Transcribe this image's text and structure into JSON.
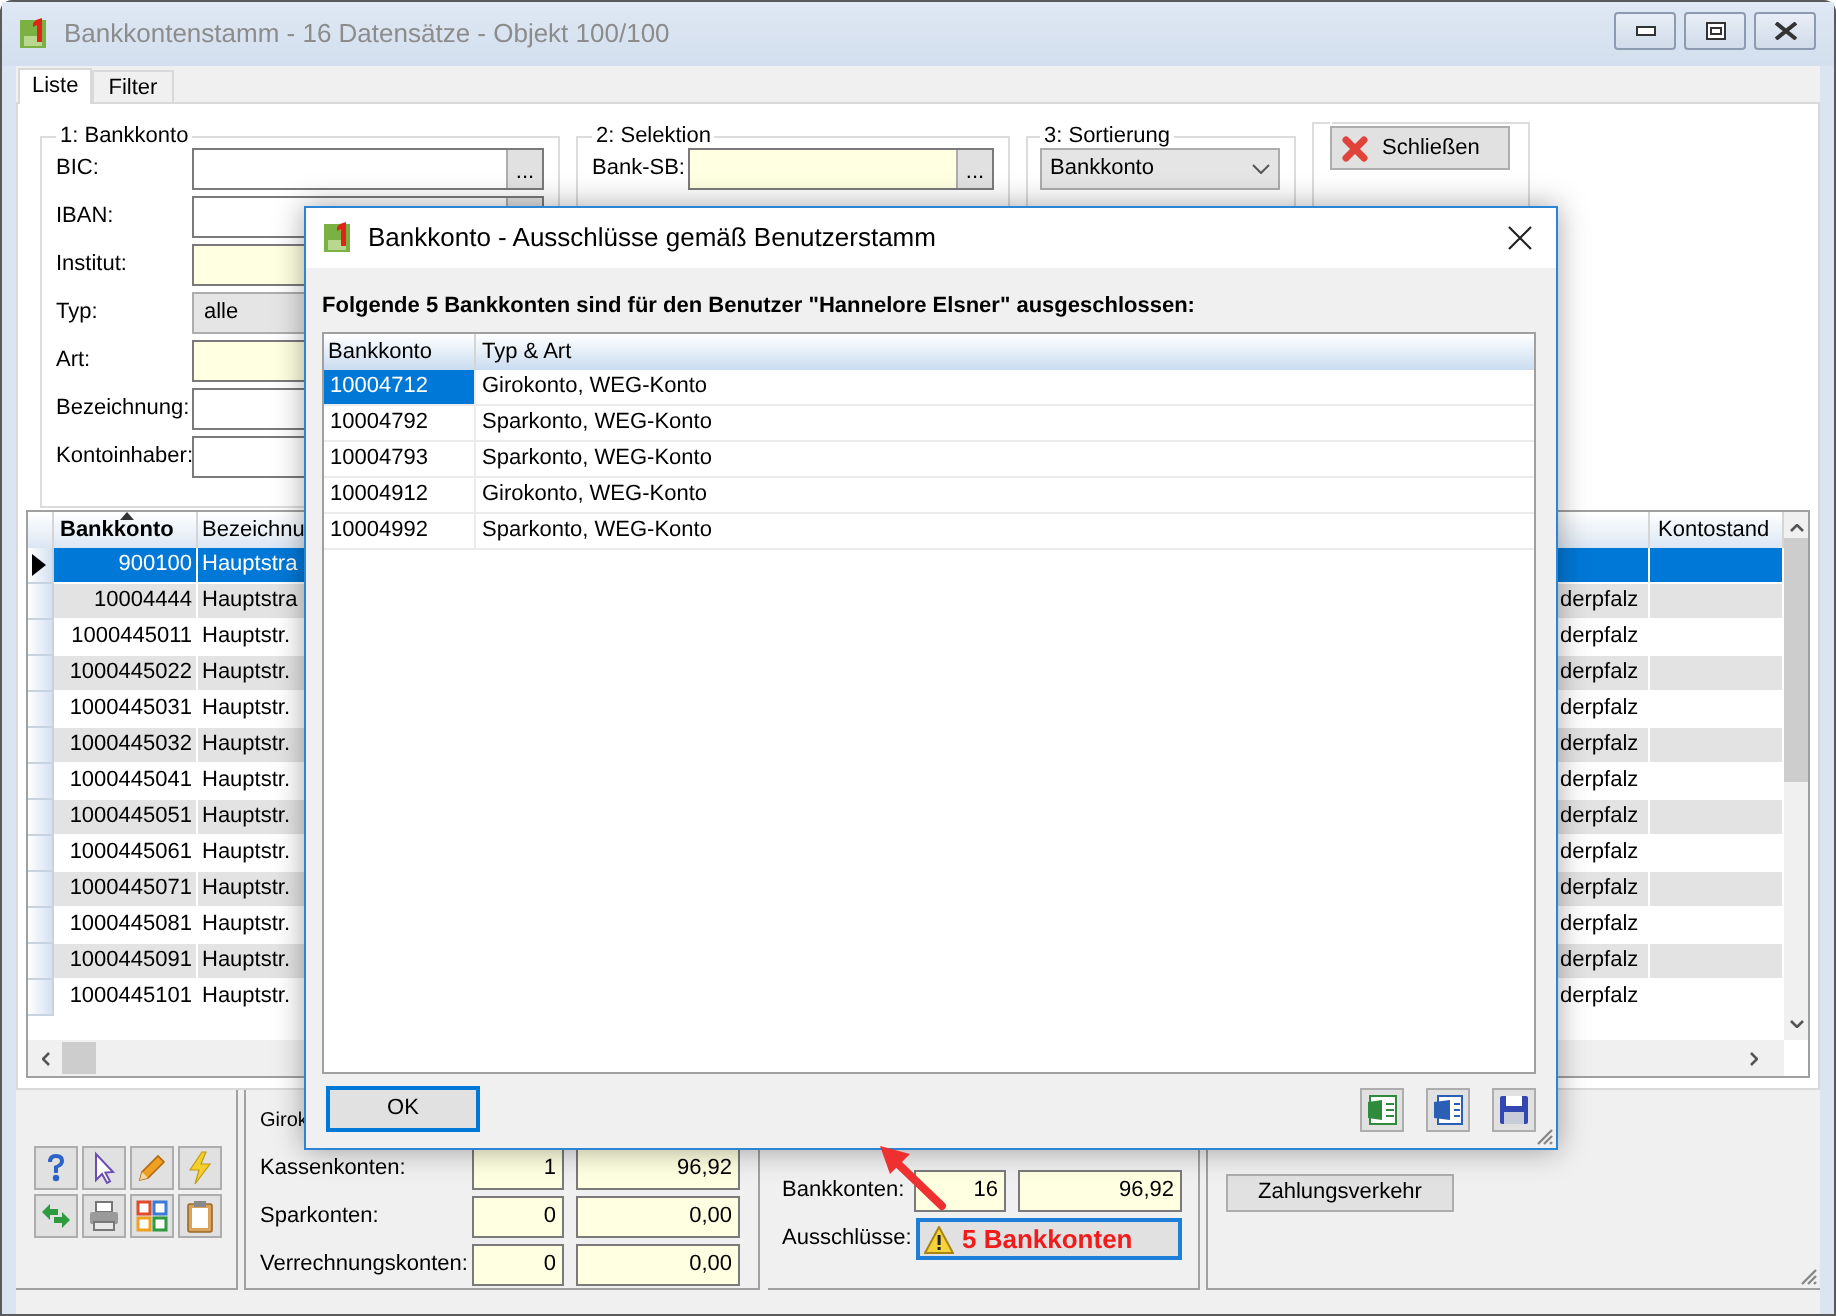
{
  "window": {
    "title": "Bankkontenstamm - 16 Datensätze - Objekt 100/100"
  },
  "tabs": [
    {
      "label": "Liste",
      "selected": true
    },
    {
      "label": "Filter",
      "selected": false
    }
  ],
  "bankkonto_group": {
    "title": "1: Bankkonto",
    "fields": [
      {
        "label": "BIC:",
        "kind": "lookup",
        "required": false,
        "button": "..."
      },
      {
        "label": "IBAN:",
        "kind": "lookup",
        "required": false
      },
      {
        "label": "Institut:",
        "kind": "text",
        "required": true
      },
      {
        "label": "Typ:",
        "kind": "combo",
        "required": false,
        "value": "alle"
      },
      {
        "label": "Art:",
        "kind": "text",
        "required": true
      },
      {
        "label": "Bezeichnung:",
        "kind": "text",
        "required": false
      },
      {
        "label": "Kontoinhaber:",
        "kind": "text",
        "required": false
      }
    ]
  },
  "selektion_group": {
    "title": "2: Selektion",
    "fields": [
      {
        "label": "Bank-SB:",
        "kind": "lookup",
        "required": true,
        "button": "..."
      }
    ]
  },
  "sortierung_group": {
    "title": "3: Sortierung",
    "value": "Bankkonto"
  },
  "close_button": {
    "label": "Schließen"
  },
  "grid": {
    "columns": {
      "bankkonto": "Bankkonto",
      "bezeichnung": "Bezeichnu",
      "kontostand": "Kontostand"
    },
    "rows": [
      {
        "bankkonto": "900100",
        "bezeichnung": "Hauptstra",
        "selected": true
      },
      {
        "bankkonto": "10004444",
        "bezeichnung": "Hauptstra",
        "column_3": "derpfalz",
        "selected": false
      },
      {
        "bankkonto": "1000445011",
        "bezeichnung": "Hauptstr.",
        "column_3": "derpfalz",
        "selected": false
      },
      {
        "bankkonto": "1000445022",
        "bezeichnung": "Hauptstr.",
        "column_3": "derpfalz",
        "selected": false
      },
      {
        "bankkonto": "1000445031",
        "bezeichnung": "Hauptstr.",
        "column_3": "derpfalz",
        "selected": false
      },
      {
        "bankkonto": "1000445032",
        "bezeichnung": "Hauptstr.",
        "column_3": "derpfalz",
        "selected": false
      },
      {
        "bankkonto": "1000445041",
        "bezeichnung": "Hauptstr.",
        "column_3": "derpfalz",
        "selected": false
      },
      {
        "bankkonto": "1000445051",
        "bezeichnung": "Hauptstr.",
        "column_3": "derpfalz",
        "selected": false
      },
      {
        "bankkonto": "1000445061",
        "bezeichnung": "Hauptstr.",
        "column_3": "derpfalz",
        "selected": false
      },
      {
        "bankkonto": "1000445071",
        "bezeichnung": "Hauptstr.",
        "column_3": "derpfalz",
        "selected": false
      },
      {
        "bankkonto": "1000445081",
        "bezeichnung": "Hauptstr.",
        "column_3": "derpfalz",
        "selected": false
      },
      {
        "bankkonto": "1000445091",
        "bezeichnung": "Hauptstr.",
        "column_3": "derpfalz",
        "selected": false
      },
      {
        "bankkonto": "1000445101",
        "bezeichnung": "Hauptstr.",
        "column_3": "derpfalz",
        "selected": false
      }
    ]
  },
  "summary": {
    "konten": [
      {
        "label": "Girok"
      },
      {
        "label": "Kassenkonten:",
        "anzahl": "1",
        "kontostand": "96,92"
      },
      {
        "label": "Sparkonten:",
        "anzahl": "0",
        "kontostand": "0,00"
      },
      {
        "label": "Verrechnungskonten:",
        "anzahl": "0",
        "kontostand": "0,00"
      }
    ],
    "totals": {
      "bankkonten": {
        "label": "Bankkonten:",
        "anzahl": "16",
        "kontostand": "96,92"
      },
      "ausschluesse": {
        "label": "Ausschlüsse:",
        "value": "5 Bankkonten",
        "warning": true
      }
    }
  },
  "zahlungsverkehr_button": {
    "label": "Zahlungsverkehr"
  },
  "dialog": {
    "title": "Bankkonto - Ausschlüsse gemäß Benutzerstamm",
    "message": "Folgende 5 Bankkonten sind für den Benutzer \"Hannelore Elsner\" ausgeschlossen:",
    "columns": [
      "Bankkonto",
      "Typ & Art"
    ],
    "rows": [
      {
        "bankkonto": "10004712",
        "typ_art": "Girokonto, WEG-Konto",
        "selected": true
      },
      {
        "bankkonto": "10004792",
        "typ_art": "Sparkonto, WEG-Konto",
        "selected": false
      },
      {
        "bankkonto": "10004793",
        "typ_art": "Sparkonto, WEG-Konto",
        "selected": false
      },
      {
        "bankkonto": "10004912",
        "typ_art": "Girokonto, WEG-Konto",
        "selected": false
      },
      {
        "bankkonto": "10004992",
        "typ_art": "Sparkonto, WEG-Konto",
        "selected": false
      }
    ],
    "ok_button": "OK"
  }
}
